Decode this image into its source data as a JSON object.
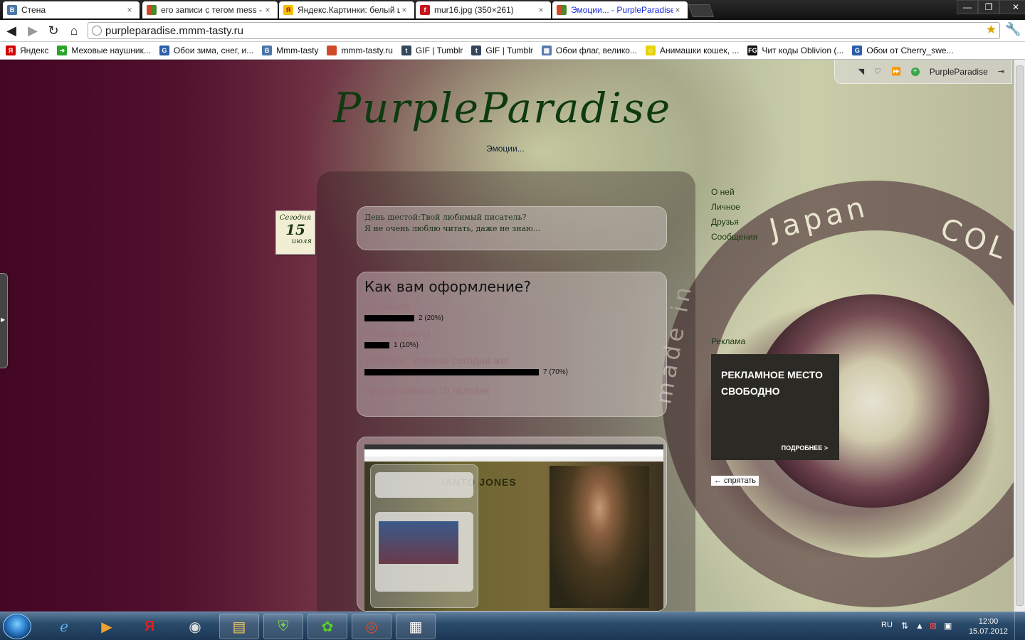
{
  "browser": {
    "tabs": [
      {
        "label": "Стена",
        "icon": "vk-icon",
        "color": "#4a76a8",
        "glyph": "B"
      },
      {
        "label": "его записи с тегом mess -",
        "icon": "mmm-tasty-icon",
        "color": "#d04a2a",
        "glyph": ""
      },
      {
        "label": "Яндекс.Картинки: белый ц",
        "icon": "yandex-images-icon",
        "color": "#f2c200",
        "glyph": "Я"
      },
      {
        "label": "mur16.jpg (350×261)",
        "icon": "free-icon",
        "color": "#c8171c",
        "glyph": "f"
      },
      {
        "label": "Эмоции... - PurpleParadise",
        "icon": "mmm-tasty-icon",
        "color": "#d04a2a",
        "glyph": ""
      }
    ],
    "address": "purpleparadise.mmm-tasty.ru",
    "bookmarks": [
      {
        "label": "Яндекс",
        "icon": "yandex-icon",
        "color": "#d20000",
        "glyph": "Я"
      },
      {
        "label": "Меховые наушник...",
        "icon": "arrow-green-icon",
        "color": "#2aa52a",
        "glyph": "➜"
      },
      {
        "label": "Обои зима, снег, и...",
        "icon": "gif-icon",
        "color": "#2d5ea8",
        "glyph": "G"
      },
      {
        "label": "Mmm-tasty",
        "icon": "vk-icon",
        "color": "#4a76a8",
        "glyph": "B"
      },
      {
        "label": "mmm-tasty.ru",
        "icon": "mmm-tasty-icon",
        "color": "#d04a2a",
        "glyph": ""
      },
      {
        "label": "GIF | Tumblr",
        "icon": "tumblr-icon",
        "color": "#35465c",
        "glyph": "t"
      },
      {
        "label": "GIF | Tumblr",
        "icon": "tumblr-icon",
        "color": "#35465c",
        "glyph": "t"
      },
      {
        "label": "Обои флаг, велико...",
        "icon": "calendar-icon",
        "color": "#5a7ab0",
        "glyph": "▦"
      },
      {
        "label": "Анимашки кошек, ...",
        "icon": "smiley-icon",
        "color": "#e8d400",
        "glyph": "☺"
      },
      {
        "label": "Чит коды Oblivion (...",
        "icon": "fg-icon",
        "color": "#111111",
        "glyph": "FG"
      },
      {
        "label": "Обои от Cherry_swe...",
        "icon": "gif-icon",
        "color": "#2d5ea8",
        "glyph": "G"
      }
    ]
  },
  "site": {
    "topbar_user": "PurpleParadise",
    "title": "PurpleParadise",
    "subtitle": "Эмоции...",
    "date": {
      "top": "Сегодня",
      "day": "15",
      "month": "июля"
    },
    "post1": {
      "line1": "День шестой:Твой любимый писатель?",
      "line2": "Я не очень люблю читать, даже не знаю..."
    },
    "poll": {
      "title": "Как вам оформление?",
      "options": [
        {
          "label": "Хорошее",
          "result": "2 (20%)",
          "fraction": 0.2
        },
        {
          "label": "Нормальное)",
          "result": "1 (10%)",
          "fraction": 0.1
        },
        {
          "label": "Ужасное, измени сегодня же!",
          "result": "7 (70%)",
          "fraction": 0.7
        }
      ],
      "total": "Проголосовало 10 человек"
    },
    "embedded_shot_title": "IANTO JONES",
    "nav": [
      "О ней",
      "Личное",
      "Друзья",
      "Сообщения",
      "",
      "",
      "",
      "",
      "",
      "",
      "Реклама"
    ],
    "ad": {
      "title": "РЕКЛАМНОЕ МЕСТО СВОБОДНО",
      "more": "ПОДРОБНЕЕ >"
    },
    "hide_button": "← спрятать",
    "lens_text_1": "Japan",
    "lens_text_2": "made in",
    "lens_text_3": "COL"
  },
  "taskbar": {
    "lang": "RU",
    "time": "12:00",
    "date": "15.07.2012"
  }
}
